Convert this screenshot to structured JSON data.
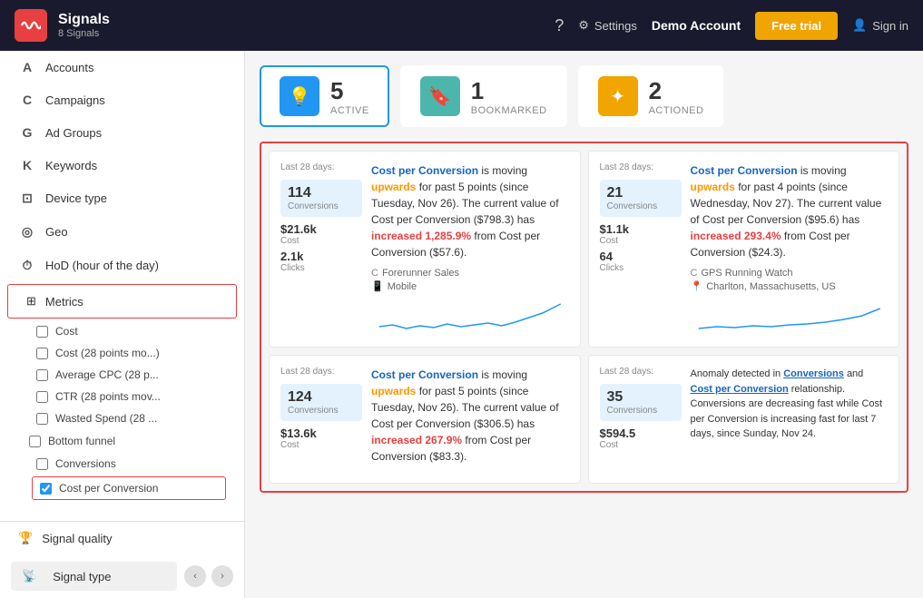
{
  "header": {
    "logo_label": "Signals",
    "subtitle": "8 Signals",
    "help_icon": "?",
    "settings_label": "Settings",
    "demo_account": "Demo Account",
    "free_trial": "Free trial",
    "signin": "Sign in"
  },
  "sidebar": {
    "items": [
      {
        "id": "accounts",
        "icon": "A",
        "label": "Accounts"
      },
      {
        "id": "campaigns",
        "icon": "C",
        "label": "Campaigns"
      },
      {
        "id": "adgroups",
        "icon": "G",
        "label": "Ad Groups"
      },
      {
        "id": "keywords",
        "icon": "K",
        "label": "Keywords"
      },
      {
        "id": "devicetype",
        "icon": "⊡",
        "label": "Device type"
      },
      {
        "id": "geo",
        "icon": "◎",
        "label": "Geo"
      },
      {
        "id": "hod",
        "icon": "⏱",
        "label": "HoD (hour of the day)"
      }
    ],
    "metrics_label": "Metrics",
    "checkboxes": [
      {
        "id": "cost",
        "label": "Cost",
        "checked": false
      },
      {
        "id": "cost28",
        "label": "Cost (28 points mo...)",
        "checked": false
      },
      {
        "id": "avgcpc",
        "label": "Average CPC (28 p...",
        "checked": false
      },
      {
        "id": "ctr",
        "label": "CTR (28 points mov...",
        "checked": false
      },
      {
        "id": "wastedspend",
        "label": "Wasted Spend (28 ...",
        "checked": false
      }
    ],
    "bottom_funnel_label": "Bottom funnel",
    "conversions_label": "Conversions",
    "cost_per_conversion_label": "Cost per Conversion",
    "signal_quality_label": "Signal quality",
    "signal_type_label": "Signal type"
  },
  "tabs": [
    {
      "id": "active",
      "icon": "💡",
      "count": "5",
      "label": "Active",
      "active": true,
      "icon_color": "blue"
    },
    {
      "id": "bookmarked",
      "icon": "🔖",
      "count": "1",
      "label": "Bookmarked",
      "active": false,
      "icon_color": "teal"
    },
    {
      "id": "actioned",
      "icon": "✦",
      "count": "2",
      "label": "Actioned",
      "active": false,
      "icon_color": "orange"
    }
  ],
  "signals": [
    {
      "id": "signal1",
      "days": "Last 28 days:",
      "stat1_value": "114",
      "stat1_label": "Conversions",
      "stat2_value": "$21.6k",
      "stat2_label": "Cost",
      "stat3_value": "2.1k",
      "stat3_label": "Clicks",
      "title_metric": "Cost per Conversion",
      "title_direction": "upwards",
      "title_text1": " is moving ",
      "title_text2": " for past 5 points (since Tuesday, Nov 26). The current value of Cost per Conversion ($798.3) has ",
      "title_increased": "increased 1,285.9%",
      "title_text3": " from Cost per Conversion ($57.6).",
      "campaign": "Forerunner Sales",
      "device": "Mobile",
      "chart_type": "line"
    },
    {
      "id": "signal2",
      "days": "Last 28 days:",
      "stat1_value": "21",
      "stat1_label": "Conversions",
      "stat2_value": "$1.1k",
      "stat2_label": "Cost",
      "stat3_value": "64",
      "stat3_label": "Clicks",
      "title_metric": "Cost per Conversion",
      "title_direction": "upwards",
      "title_text1": " is moving ",
      "title_text2": " for past 4 points (since Wednesday, Nov 27). The current value of Cost per Conversion ($95.6) has ",
      "title_increased": "increased 293.4%",
      "title_text3": " from Cost per Conversion ($24.3).",
      "campaign": "GPS Running Watch",
      "location": "Charlton, Massachusetts, US",
      "chart_type": "line"
    },
    {
      "id": "signal3",
      "days": "Last 28 days:",
      "stat1_value": "124",
      "stat1_label": "Conversions",
      "stat2_value": "$13.6k",
      "stat2_label": "Cost",
      "stat3_value": "",
      "stat3_label": "",
      "title_metric": "Cost per Conversion",
      "title_direction": "upwards",
      "title_text1": " is moving ",
      "title_text2": " for past 5 points (since Tuesday, Nov 26). The current value of Cost per Conversion ($306.5) has ",
      "title_increased": "increased 267.9%",
      "title_text3": " from Cost per Conversion ($83.3).",
      "campaign": "",
      "location": "",
      "chart_type": "line"
    },
    {
      "id": "signal4",
      "days": "Last 28 days:",
      "stat1_value": "35",
      "stat1_label": "Conversions",
      "stat2_value": "$594.5",
      "stat2_label": "Cost",
      "stat3_value": "",
      "stat3_label": "",
      "anomaly": true,
      "anomaly_text1": "Anomaly detected in ",
      "anomaly_link1": "Conversions",
      "anomaly_text2": " and ",
      "anomaly_link2": "Cost per Conversion",
      "anomaly_text3": " relationship. Conversions are ",
      "anomaly_decreasing": "decreasing fast",
      "anomaly_text4": " while Cost per Conversion is ",
      "anomaly_increasing": "increasing fast",
      "anomaly_text5": " for last 7 days, since Sunday, Nov 24.",
      "chart_type": "none"
    }
  ]
}
